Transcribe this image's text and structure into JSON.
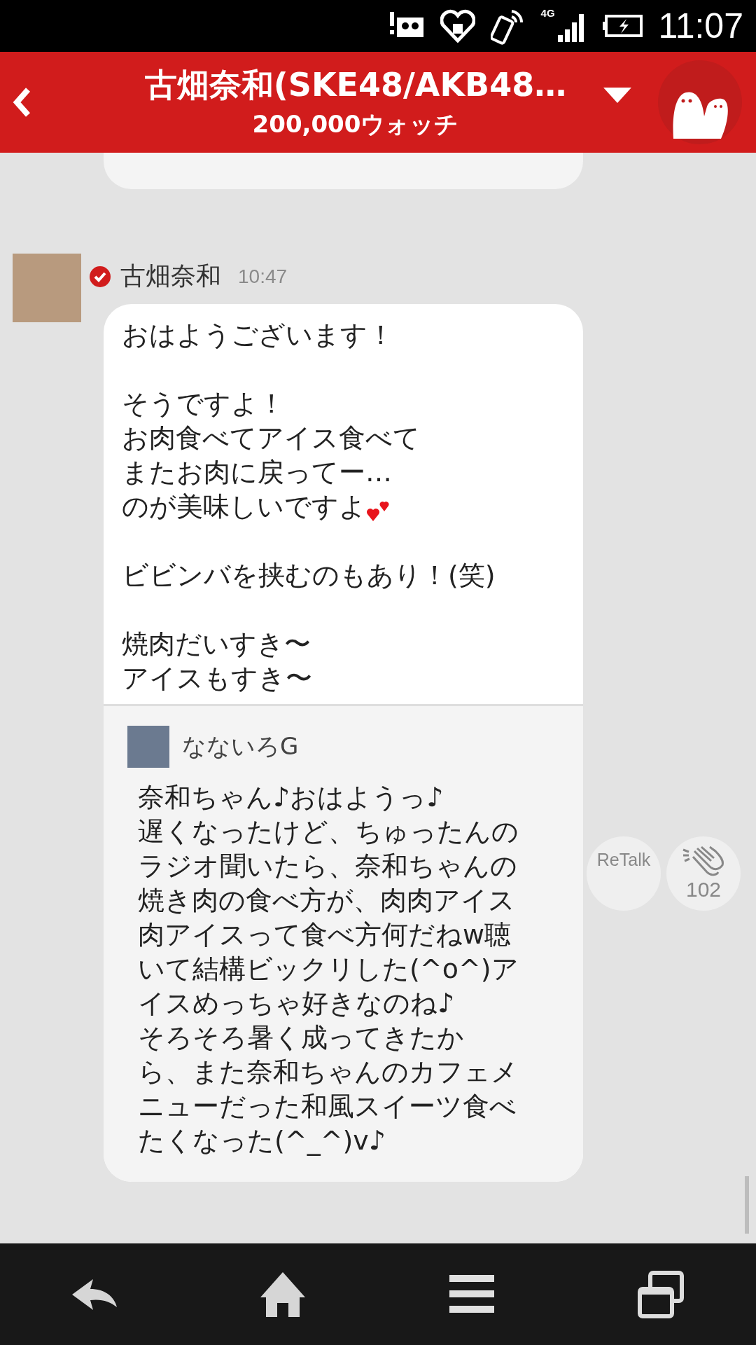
{
  "status_bar": {
    "network": "4G",
    "time": "11:07"
  },
  "header": {
    "title": "古畑奈和(SKE48/AKB48…",
    "subtitle": "200,000ウォッチ"
  },
  "post": {
    "author": "古畑奈和",
    "verified": true,
    "time": "10:47",
    "paragraphs": [
      {
        "lines": [
          {
            "text": "おはようございます！",
            "hearts": false
          }
        ]
      },
      {
        "lines": [
          {
            "text": "そうですよ！",
            "hearts": false
          },
          {
            "text": "お肉食べてアイス食べて",
            "hearts": false
          },
          {
            "text": "またお肉に戻ってー…",
            "hearts": false
          },
          {
            "text": "のが美味しいですよ",
            "hearts": true
          }
        ]
      },
      {
        "lines": [
          {
            "text": "ビビンバを挟むのもあり！(笑)",
            "hearts": false
          }
        ]
      },
      {
        "lines": [
          {
            "text": "焼肉だいすき〜",
            "hearts": false
          },
          {
            "text": "アイスもすき〜",
            "hearts": false
          }
        ]
      }
    ],
    "quote": {
      "author": "なないろG",
      "lines": [
        "奈和ちゃん♪おはようっ♪",
        "遅くなったけど、ちゅったんの",
        "ラジオ聞いたら、奈和ちゃんの",
        "焼き肉の食べ方が、肉肉アイス",
        "肉アイスって食べ方何だねw聴",
        "いて結構ビックリした(^o^)ア",
        "イスめっちゃ好きなのね♪",
        "そろそろ暑く成ってきたか",
        "ら、また奈和ちゃんのカフェメ",
        "ニューだった和風スイーツ食べ",
        "たくなった(^_^)v♪"
      ]
    },
    "retalk_label": "ReTalk",
    "clap_count": "102"
  }
}
